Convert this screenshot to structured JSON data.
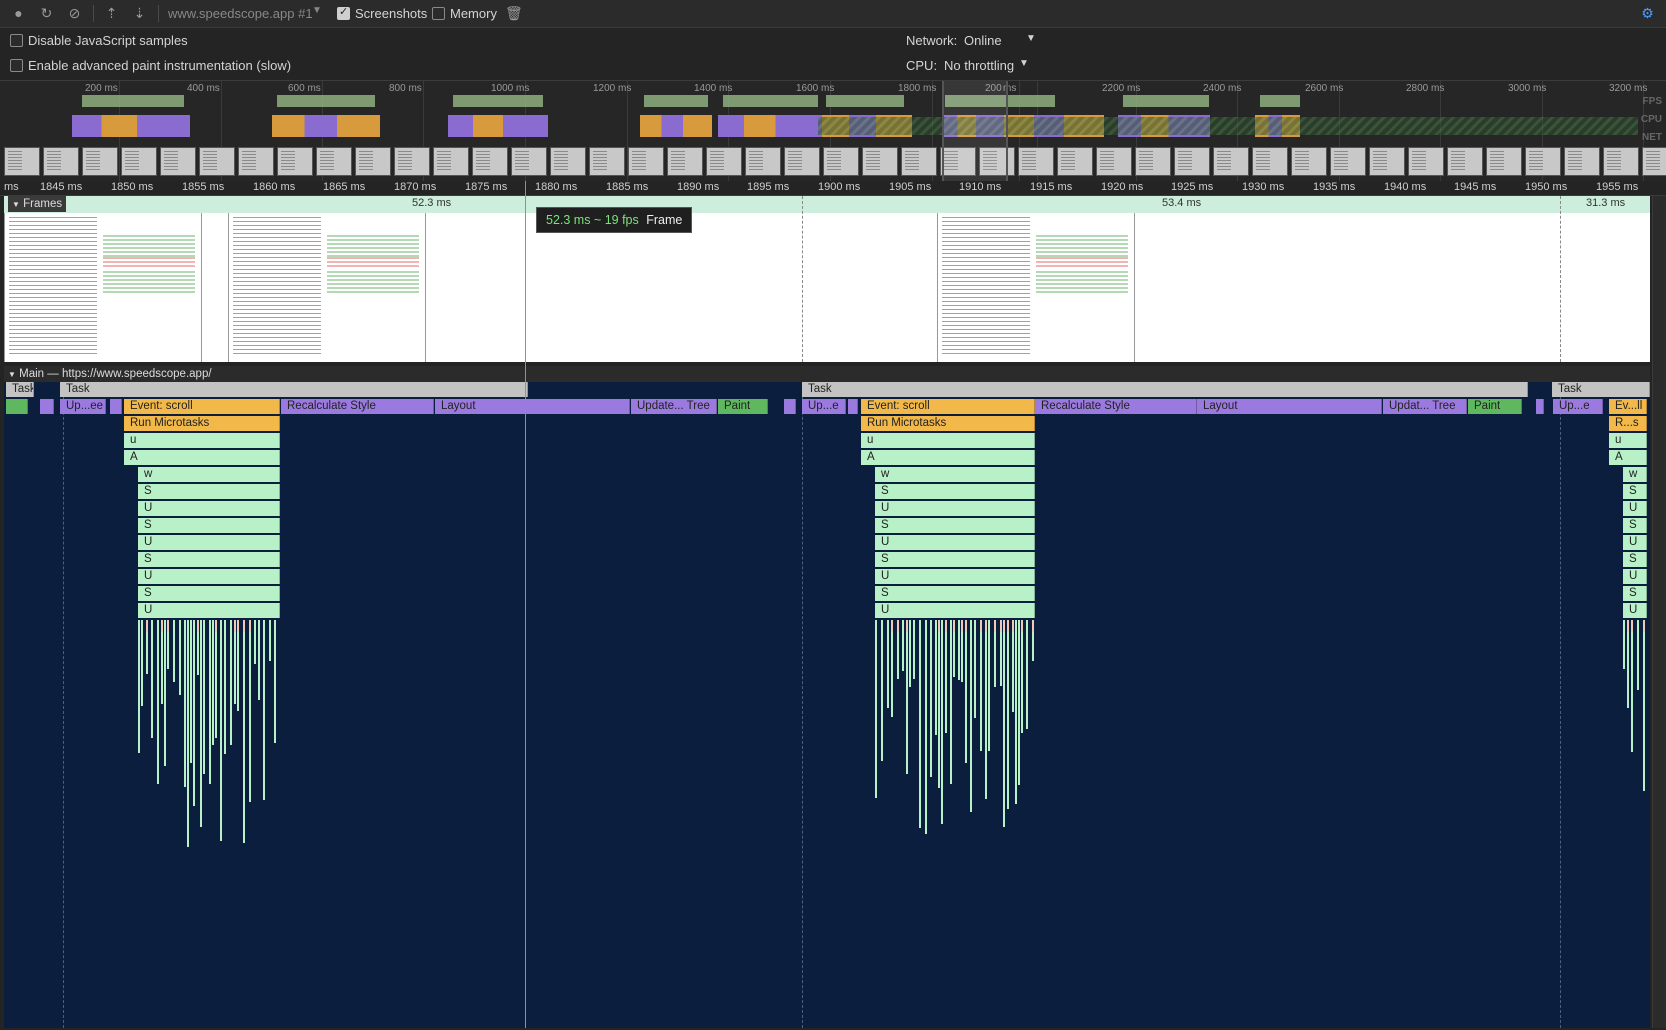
{
  "toolbar": {
    "profile_select": "www.speedscope.app #1",
    "screenshots_label": "Screenshots",
    "screenshots_checked": true,
    "memory_label": "Memory",
    "memory_checked": false
  },
  "settings": {
    "disable_js_samples": "Disable JavaScript samples",
    "advanced_paint": "Enable advanced paint instrumentation (slow)",
    "network_label": "Network:",
    "network_value": "Online",
    "cpu_label": "CPU:",
    "cpu_value": "No throttling"
  },
  "overview": {
    "ticks": [
      "200 ms",
      "400 ms",
      "600 ms",
      "800 ms",
      "1000 ms",
      "1200 ms",
      "1400 ms",
      "1600 ms",
      "1800 ms",
      "200",
      "ms",
      "2200 ms",
      "2400 ms",
      "2600 ms",
      "2800 ms",
      "3000 ms",
      "3200 ms"
    ],
    "fps_label": "FPS",
    "cpu_label": "CPU",
    "net_label": "NET"
  },
  "ruler": [
    "ms",
    "1845 ms",
    "1850 ms",
    "1855 ms",
    "1860 ms",
    "1865 ms",
    "1870 ms",
    "1875 ms",
    "1880 ms",
    "1885 ms",
    "1890 ms",
    "1895 ms",
    "1900 ms",
    "1905 ms",
    "1910 ms",
    "1915 ms",
    "1920 ms",
    "1925 ms",
    "1930 ms",
    "1935 ms",
    "1940 ms",
    "1945 ms",
    "1950 ms",
    "1955 ms"
  ],
  "frames": {
    "title": "Frames",
    "durations": [
      "52.3 ms",
      "53.4 ms",
      "31.3 ms"
    ],
    "tooltip_time": "52.3 ms ~ 19 fps",
    "tooltip_kind": "Frame"
  },
  "main": {
    "title": "Main — https://www.speedscope.app/",
    "tasks": [
      "Task",
      "Task",
      "Task",
      "Task"
    ],
    "row2": [
      "Up...ee",
      "Event: scroll",
      "Recalculate Style",
      "Layout",
      "Update... Tree",
      "Paint",
      "Up...e",
      "Event: scroll",
      "Recalculate Style",
      "Layout",
      "Updat... Tree",
      "Paint",
      "Up...e",
      "Ev...ll"
    ],
    "microtasks": [
      "Run Microtasks",
      "Run Microtasks",
      "R...s"
    ],
    "stack": [
      "u",
      "A",
      "w",
      "S",
      "U",
      "S",
      "U",
      "S",
      "U",
      "S",
      "U"
    ]
  },
  "colors": {
    "task": "#c3c3c3",
    "rendering": "#9b7ae0",
    "scripting": "#f2b94a",
    "js_frame": "#b8f0c8",
    "painting": "#5fb85f",
    "flame_bg": "#0b1e3d",
    "cursor": "#4aa0ff"
  }
}
